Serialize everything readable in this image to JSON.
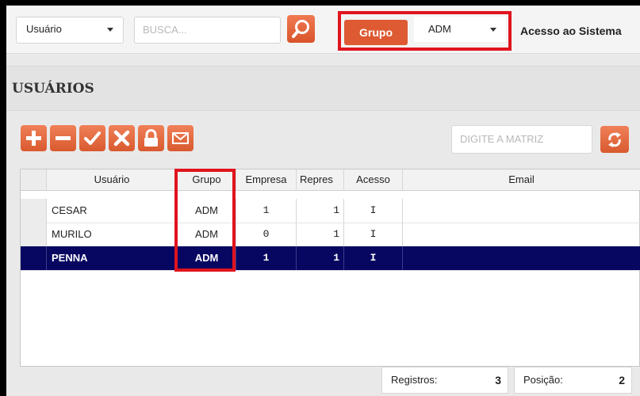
{
  "topbar": {
    "user_select": "Usuário",
    "search_placeholder": "BUSCA...",
    "group_label": "Grupo",
    "group_select": "ADM",
    "access_label": "Acesso ao Sistema"
  },
  "panel": {
    "title": "USUÁRIOS",
    "matrix_placeholder": "DIGITE A MATRIZ",
    "toolbar_icons": [
      "add-icon",
      "remove-icon",
      "check-icon",
      "cancel-icon",
      "lock-icon",
      "mail-icon"
    ]
  },
  "table": {
    "columns": [
      "Usuário",
      "Grupo",
      "Empresa",
      "Repres",
      "Acesso",
      "Email"
    ],
    "rows": [
      {
        "usuario": "CESAR",
        "grupo": "ADM",
        "empresa": "1",
        "repres": "1",
        "acesso": "I",
        "email": ""
      },
      {
        "usuario": "MURILO",
        "grupo": "ADM",
        "empresa": "0",
        "repres": "1",
        "acesso": "I",
        "email": ""
      },
      {
        "usuario": "PENNA",
        "grupo": "ADM",
        "empresa": "1",
        "repres": "1",
        "acesso": "I",
        "email": ""
      }
    ],
    "selected_row": 2
  },
  "footer": {
    "registros_label": "Registros:",
    "registros_value": "3",
    "posicao_label": "Posição:",
    "posicao_value": "2"
  },
  "colors": {
    "accent": "#dd5a33",
    "highlight_box": "#e0141e",
    "selected_row": "#070660"
  }
}
